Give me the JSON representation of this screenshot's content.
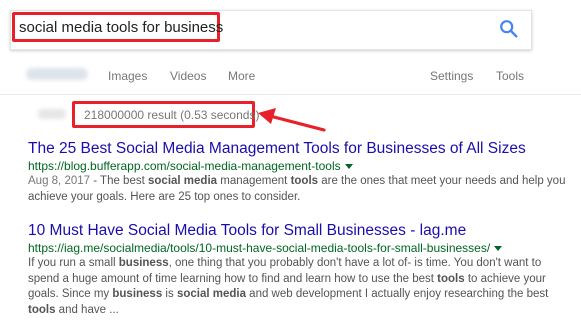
{
  "search": {
    "query": "social media tools for business"
  },
  "tabs": {
    "images": "Images",
    "videos": "Videos",
    "more": "More",
    "settings": "Settings",
    "tools": "Tools"
  },
  "stats": {
    "text": "218000000 result (0.53 seconds)"
  },
  "colors": {
    "highlight": "#e8202a",
    "link": "#1a0dab",
    "url": "#006621",
    "search_icon": "#4285f4"
  },
  "results": [
    {
      "title": "The 25 Best Social Media Management Tools for Businesses of All Sizes",
      "url": "https://blog.bufferapp.com/social-media-management-tools",
      "date": "Aug 8, 2017",
      "snippet_1": " - The best ",
      "snippet_b1": "social media",
      "snippet_2": " management ",
      "snippet_b2": "tools",
      "snippet_3": " are the ones that meet your needs and help you achieve your goals. Here are 25 top ones to consider."
    },
    {
      "title": "10 Must Have Social Media Tools for Small Businesses - lag.me",
      "url": "https://iag.me/socialmedia/tools/10-must-have-social-media-tools-for-small-businesses/",
      "snippet_1": "If you run a small ",
      "snippet_b1": "business",
      "snippet_2": ", one thing that you probably don't have a lot of- is time. You don't want to spend a huge amount of time learning how to find and learn how to use the best ",
      "snippet_b2": "tools",
      "snippet_3": " to achieve your goals. Since my ",
      "snippet_b3": "business",
      "snippet_4": " is ",
      "snippet_b4": "social media",
      "snippet_5": " and web development I actually enjoy researching the best ",
      "snippet_b5": "tools",
      "snippet_6": " and have ..."
    }
  ]
}
